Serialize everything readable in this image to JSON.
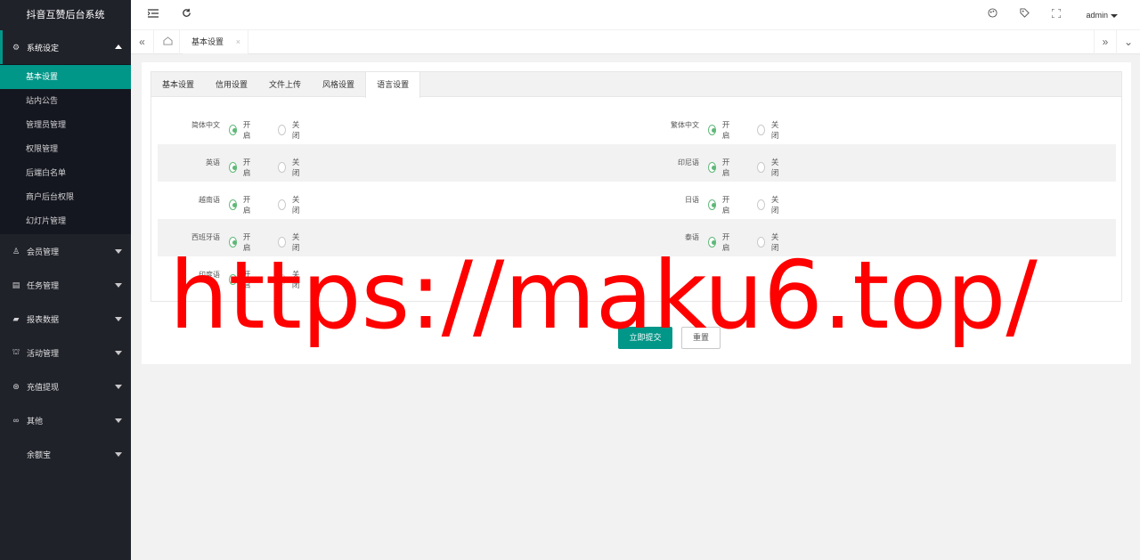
{
  "app": {
    "title": "抖音互赞后台系统"
  },
  "sidebar": {
    "menus": [
      {
        "label": "系统设定",
        "icon": "gear-icon",
        "icon_glyph": "⚙",
        "open": true,
        "children": [
          "基本设置",
          "站内公告",
          "管理员管理",
          "权限管理",
          "后端白名单",
          "商户后台权限",
          "幻灯片管理"
        ]
      },
      {
        "label": "会员管理",
        "icon": "user-icon",
        "icon_glyph": "♙"
      },
      {
        "label": "任务管理",
        "icon": "task-icon",
        "icon_glyph": "▤"
      },
      {
        "label": "报表数据",
        "icon": "report-icon",
        "icon_glyph": "▰"
      },
      {
        "label": "活动管理",
        "icon": "activity-icon",
        "icon_glyph": "⛫"
      },
      {
        "label": "充值提现",
        "icon": "money-icon",
        "icon_glyph": "⊛"
      },
      {
        "label": "其他",
        "icon": "infinity-icon",
        "icon_glyph": "∞"
      },
      {
        "label": "余额宝",
        "icon": "",
        "icon_glyph": ""
      }
    ],
    "active_child": "基本设置"
  },
  "header": {
    "user": "admin",
    "icons": [
      "collapse-menu-icon",
      "refresh-icon",
      "theme-icon",
      "tag-icon",
      "fullscreen-icon"
    ]
  },
  "tabsbar": {
    "page_tab": "基本设置",
    "close_glyph": "×"
  },
  "form": {
    "tabs": [
      "基本设置",
      "信用设置",
      "文件上传",
      "风格设置",
      "语言设置"
    ],
    "active_tab": "语言设置",
    "on_label": "开启",
    "off_label": "关闭",
    "rows": [
      {
        "left": "简体中文",
        "right": "繁体中文"
      },
      {
        "left": "英语",
        "right": "印尼语"
      },
      {
        "left": "越南语",
        "right": "日语"
      },
      {
        "left": "西班牙语",
        "right": "泰语"
      },
      {
        "left": "印度语",
        "right": null
      }
    ],
    "submit": "立即提交",
    "reset": "重置"
  },
  "watermark": "https://maku6.top/",
  "colors": {
    "accent": "#009688",
    "radio_on": "#5fb878",
    "sidebar": "#20222a",
    "watermark": "#ff0000"
  }
}
